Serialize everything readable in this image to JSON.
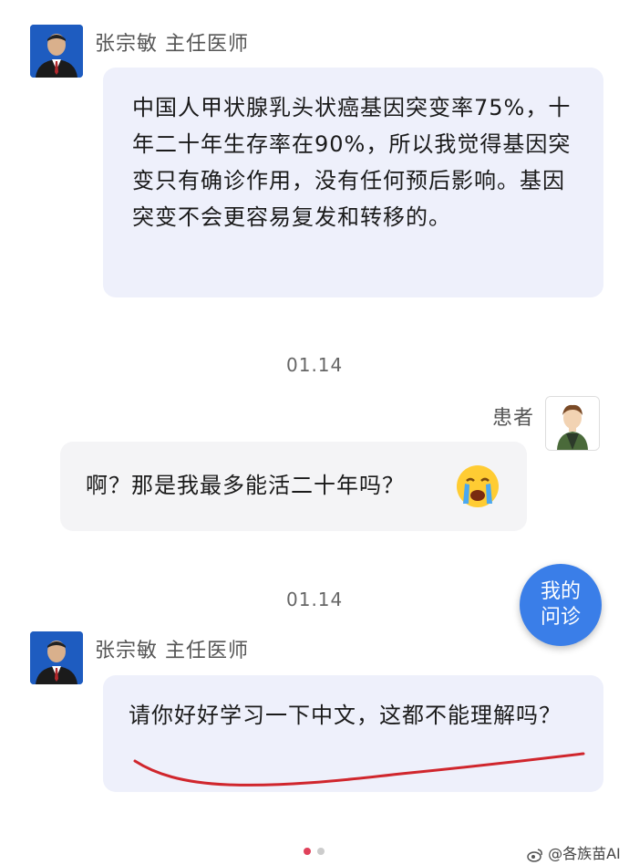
{
  "messages": [
    {
      "sender": "张宗敏 主任医师",
      "text": "中国人甲状腺乳头状癌基因突变率75%，十年二十年生存率在90%，所以我觉得基因突变只有确诊作用，没有任何预后影响。基因突变不会更容易复发和转移的。"
    },
    {
      "time": "01.14",
      "sender": "患者",
      "text": "啊？那是我最多能活二十年吗？",
      "emoji": "crying-face-icon"
    },
    {
      "time": "01.14",
      "sender": "张宗敏 主任医师",
      "text": "请你好好学习一下中文，这都不能理解吗？"
    }
  ],
  "fab": {
    "label": "我的问诊"
  },
  "watermark": "@各族苗AI",
  "colors": {
    "doctor_bubble": "#eef0fb",
    "patient_bubble": "#f4f4f6",
    "fab": "#3a7ee8",
    "underline": "#d0262d",
    "dot_active": "#e0415a",
    "dot_inactive": "#cccccc"
  }
}
